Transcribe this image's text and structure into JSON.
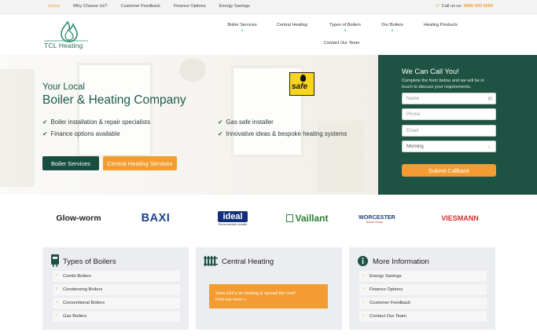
{
  "topbar": {
    "nav": [
      "Home",
      "Why Choose Us?",
      "Customer Feedback",
      "Finance Options",
      "Energy Savings"
    ],
    "active_index": 0,
    "call_label": "Call us on",
    "phone": "0800 000 0000"
  },
  "header": {
    "logo_text": "TCL Heating",
    "nav": {
      "boiler_services": "Boiler Services",
      "central_heating": "Central Heating",
      "types_of_boilers": "Types of Boilers",
      "our_boilers": "Our Boilers",
      "heating_products": "Heating Products",
      "contact": "Contact Our Team"
    }
  },
  "hero": {
    "subtitle": "Your Local",
    "title": "Boiler & Heating Company",
    "badge_text": "safe",
    "features": [
      "Boiler installation & repair specialists",
      "Gas safe installer",
      "Finance options available",
      "Innovative ideas & bespoke heating systems"
    ],
    "btn_primary": "Boiler Services",
    "btn_secondary": "Central Heating Services"
  },
  "callback": {
    "title": "We Can Call You!",
    "description": "Complete the form below and we will be in touch to discuss your requirements.",
    "name_placeholder": "Name",
    "phone_placeholder": "Phone",
    "email_placeholder": "Email",
    "time_value": "Morning",
    "submit_label": "Submit Callback"
  },
  "brands": {
    "glowworm": "Glow-worm",
    "baxi": "BAXI",
    "ideal": "ideal",
    "ideal_sub": "Recommended Installer",
    "vaillant": "Vaillant",
    "worcester": "WORCESTER",
    "worcester_sub": "Bosch Group",
    "viessmann": "VIESMANN"
  },
  "cards": {
    "types": {
      "title": "Types of Boilers",
      "items": [
        "Combi Boilers",
        "Condensing Boilers",
        "Conventional Boilers",
        "Gas Boilers"
      ]
    },
    "central": {
      "title": "Central Heating",
      "promo_line1": "Save £££'s on heating & spread the cost!",
      "promo_line2": "Find out more »"
    },
    "info": {
      "title": "More Information",
      "items": [
        "Energy Savings",
        "Finance Options",
        "Customer Feedback",
        "Contact Our Team"
      ]
    }
  },
  "colors": {
    "brand_green": "#1e5242",
    "accent_orange": "#f39c32",
    "nav_teal": "#2aa3b8"
  }
}
